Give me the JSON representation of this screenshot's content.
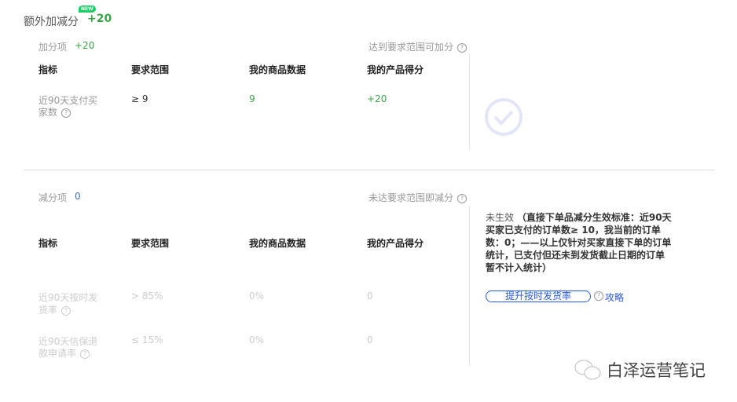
{
  "title": "额外加减分",
  "total": "+20",
  "badge": "NEW",
  "columns": [
    "指标",
    "要求范围",
    "我的商品数据",
    "我的产品得分"
  ],
  "add": {
    "label": "加分项",
    "score": "+20",
    "hint": "达到要求范围可加分",
    "rows": [
      {
        "metric_l1": "近90天支付买",
        "metric_l2": "家数",
        "range": "≥ 9",
        "data": "9",
        "score": "+20"
      }
    ]
  },
  "sub": {
    "label": "减分项",
    "score": "0",
    "hint": "未达要求范围即减分",
    "status": "未生效",
    "note": [
      "（直接下单品减分生效标准：近90天",
      "买家已支付的订单数≥ 10，我当前的订单",
      "数：0；——以上仅针对买家直接下单的订单",
      "统计，已支付但还未到发货截止日期的订单",
      "暂不计入统计）"
    ],
    "button": "提升按时发货率",
    "guide": "攻略",
    "rows": [
      {
        "metric_l1": "近90天按时发",
        "metric_l2": "货率",
        "range": "> 85%",
        "data": "0%",
        "score": "0"
      },
      {
        "metric_l1": "近90天信保退",
        "metric_l2": "款申请率",
        "range": "≤ 15%",
        "data": "0%",
        "score": "0"
      }
    ]
  },
  "watermark": "白泽运营笔记"
}
